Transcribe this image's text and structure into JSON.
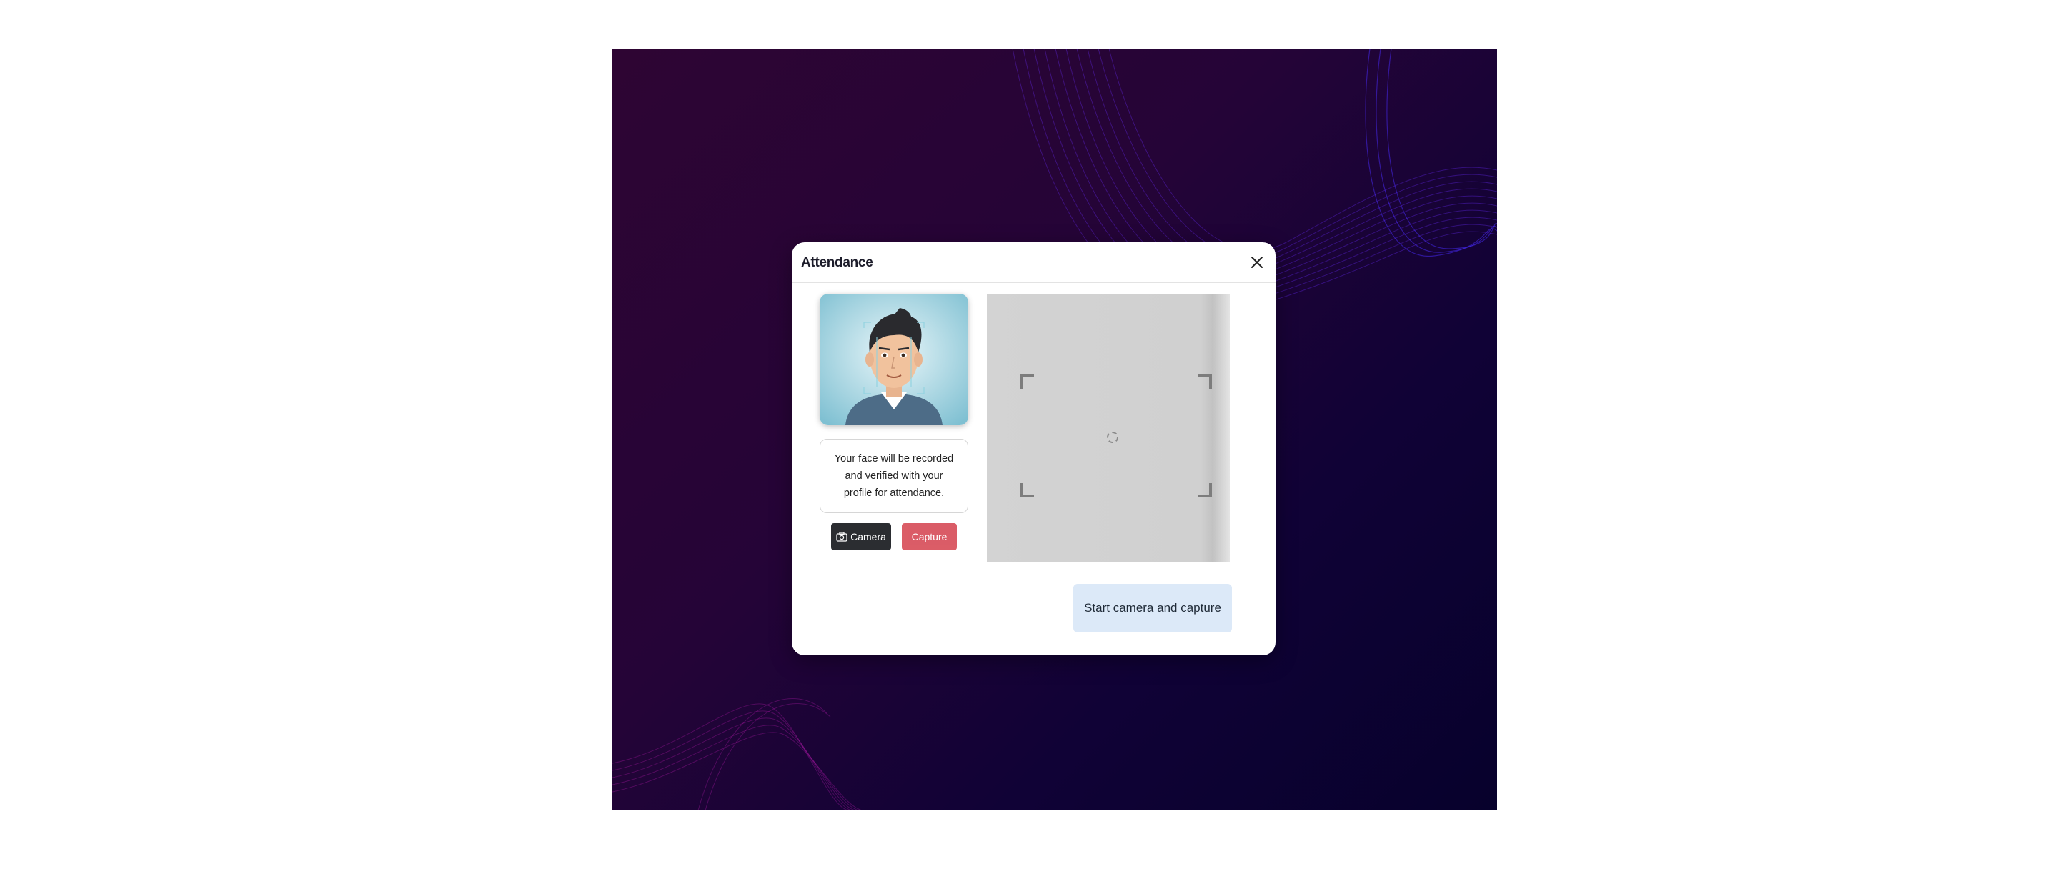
{
  "modal": {
    "title": "Attendance"
  },
  "info": {
    "message": "Your face will be recorded and verified with your profile for attendance."
  },
  "buttons": {
    "camera_label": "Camera",
    "capture_label": "Capture",
    "start_label": "Start camera and capture"
  },
  "icons": {
    "close": "close-icon",
    "camera": "camera-icon",
    "spinner": "loading-spinner-icon"
  },
  "colors": {
    "camera_button": "#2b2d31",
    "capture_button": "#d9545f",
    "start_button": "#dce9f8",
    "backdrop_start": "#2e0533",
    "backdrop_end": "#07012c"
  }
}
